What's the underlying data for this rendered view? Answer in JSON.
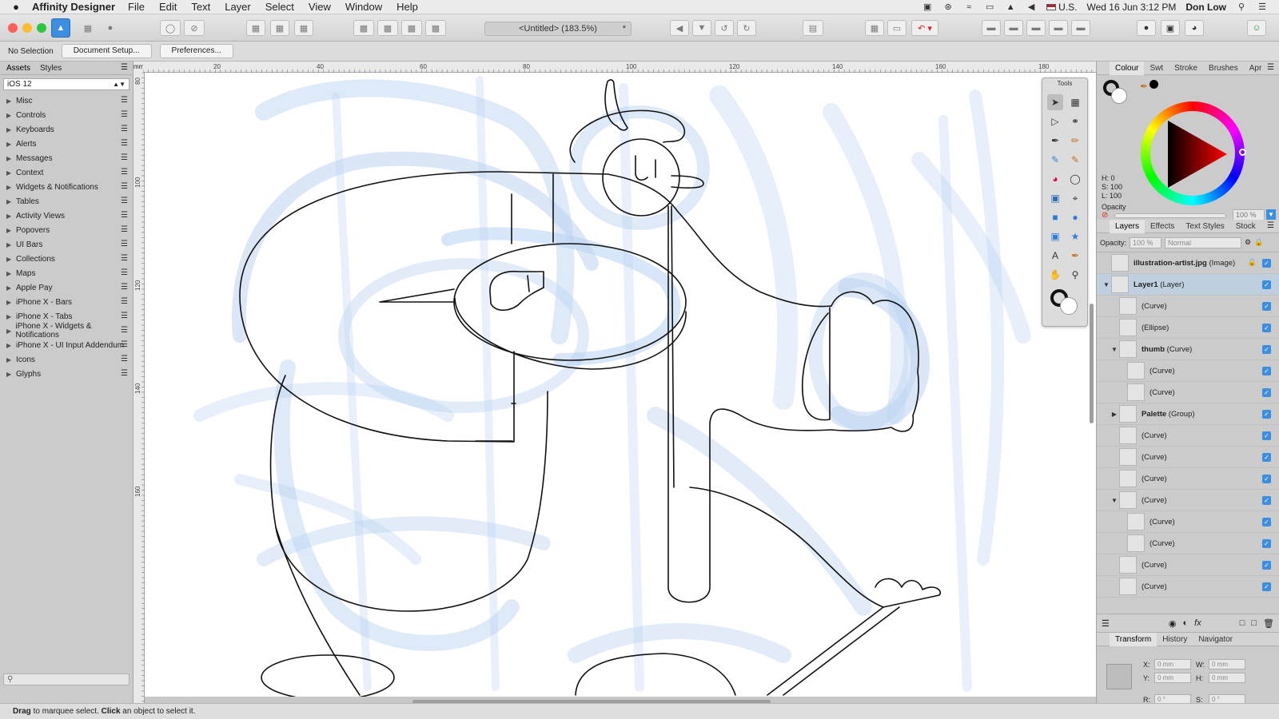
{
  "menubar": {
    "apple": "",
    "app_name": "Affinity Designer",
    "menus": [
      "File",
      "Edit",
      "Text",
      "Layer",
      "Select",
      "View",
      "Window",
      "Help"
    ],
    "input_source": "U.S.",
    "clock": "Wed 16 Jun  3:12 PM",
    "user": "Don Low"
  },
  "toolbar": {
    "doc_title": "<Untitled> (183.5%)",
    "modified_mark": "*"
  },
  "context": {
    "selection": "No Selection",
    "doc_setup": "Document Setup...",
    "preferences": "Preferences..."
  },
  "left_panel": {
    "tabs": [
      "Assets",
      "Styles"
    ],
    "category": "iOS 12",
    "items": [
      "Misc",
      "Controls",
      "Keyboards",
      "Alerts",
      "Messages",
      "Context",
      "Widgets & Notifications",
      "Tables",
      "Activity Views",
      "Popovers",
      "UI Bars",
      "Collections",
      "Maps",
      "Apple Pay",
      "iPhone X - Bars",
      "iPhone X - Tabs",
      "iPhone X - Widgets & Notifications",
      "iPhone X - UI Input Addendum",
      "Icons",
      "Glyphs"
    ],
    "search_icon": "search-icon"
  },
  "ruler": {
    "unit": "mm",
    "top_ticks": [
      "20",
      "40",
      "60",
      "80",
      "100",
      "120",
      "140",
      "160",
      "180"
    ],
    "left_ticks": [
      "80",
      "100",
      "120",
      "140",
      "160"
    ]
  },
  "tools_panel": {
    "title": "Tools"
  },
  "colour_panel": {
    "tabs": [
      "Colour",
      "Swt",
      "Stroke",
      "Brushes",
      "Apr"
    ],
    "h": "H: 0",
    "s": "S: 100",
    "l": "L: 100",
    "opacity_label": "Opacity",
    "opacity_value": "100 %"
  },
  "layers_panel": {
    "tabs": [
      "Layers",
      "Effects",
      "Text Styles",
      "Stock"
    ],
    "opacity_label": "Opacity:",
    "opacity_value": "100 %",
    "blend_mode": "Normal",
    "rows": [
      {
        "name": "illustration-artist.jpg",
        "kind": "(Image)",
        "bold": true,
        "indent": 0,
        "expand": ""
      },
      {
        "name": "Layer1",
        "kind": "(Layer)",
        "bold": false,
        "indent": 0,
        "expand": "▼"
      },
      {
        "name": "",
        "kind": "(Curve)",
        "bold": false,
        "indent": 1,
        "expand": ""
      },
      {
        "name": "",
        "kind": "(Ellipse)",
        "bold": false,
        "indent": 1,
        "expand": ""
      },
      {
        "name": "thumb",
        "kind": "(Curve)",
        "bold": true,
        "indent": 1,
        "expand": "▼"
      },
      {
        "name": "",
        "kind": "(Curve)",
        "bold": false,
        "indent": 2,
        "expand": ""
      },
      {
        "name": "",
        "kind": "(Curve)",
        "bold": false,
        "indent": 2,
        "expand": ""
      },
      {
        "name": "Palette",
        "kind": "(Group)",
        "bold": true,
        "indent": 1,
        "expand": "▶"
      },
      {
        "name": "",
        "kind": "(Curve)",
        "bold": false,
        "indent": 1,
        "expand": ""
      },
      {
        "name": "",
        "kind": "(Curve)",
        "bold": false,
        "indent": 1,
        "expand": ""
      },
      {
        "name": "",
        "kind": "(Curve)",
        "bold": false,
        "indent": 1,
        "expand": ""
      },
      {
        "name": "",
        "kind": "(Curve)",
        "bold": false,
        "indent": 1,
        "expand": "▼"
      },
      {
        "name": "",
        "kind": "(Curve)",
        "bold": false,
        "indent": 2,
        "expand": ""
      },
      {
        "name": "",
        "kind": "(Curve)",
        "bold": false,
        "indent": 2,
        "expand": ""
      },
      {
        "name": "",
        "kind": "(Curve)",
        "bold": false,
        "indent": 1,
        "expand": ""
      },
      {
        "name": "",
        "kind": "(Curve)",
        "bold": false,
        "indent": 1,
        "expand": ""
      }
    ]
  },
  "transform_panel": {
    "tabs": [
      "Transform",
      "History",
      "Navigator"
    ],
    "x_label": "X:",
    "x": "0 mm",
    "y_label": "Y:",
    "y": "0 mm",
    "w_label": "W:",
    "w": "0 mm",
    "h_label": "H:",
    "h": "0 mm",
    "r_label": "R:",
    "r": "0 °",
    "s_label": "S:",
    "s": "0 °"
  },
  "status": {
    "drag": "Drag",
    "text1": " to marquee select. ",
    "click": "Click",
    "text2": " an object to select it."
  },
  "colors": {
    "accent": "#3b8ee0",
    "sketch_blue": "#a9c8ee",
    "ink": "#111111"
  }
}
